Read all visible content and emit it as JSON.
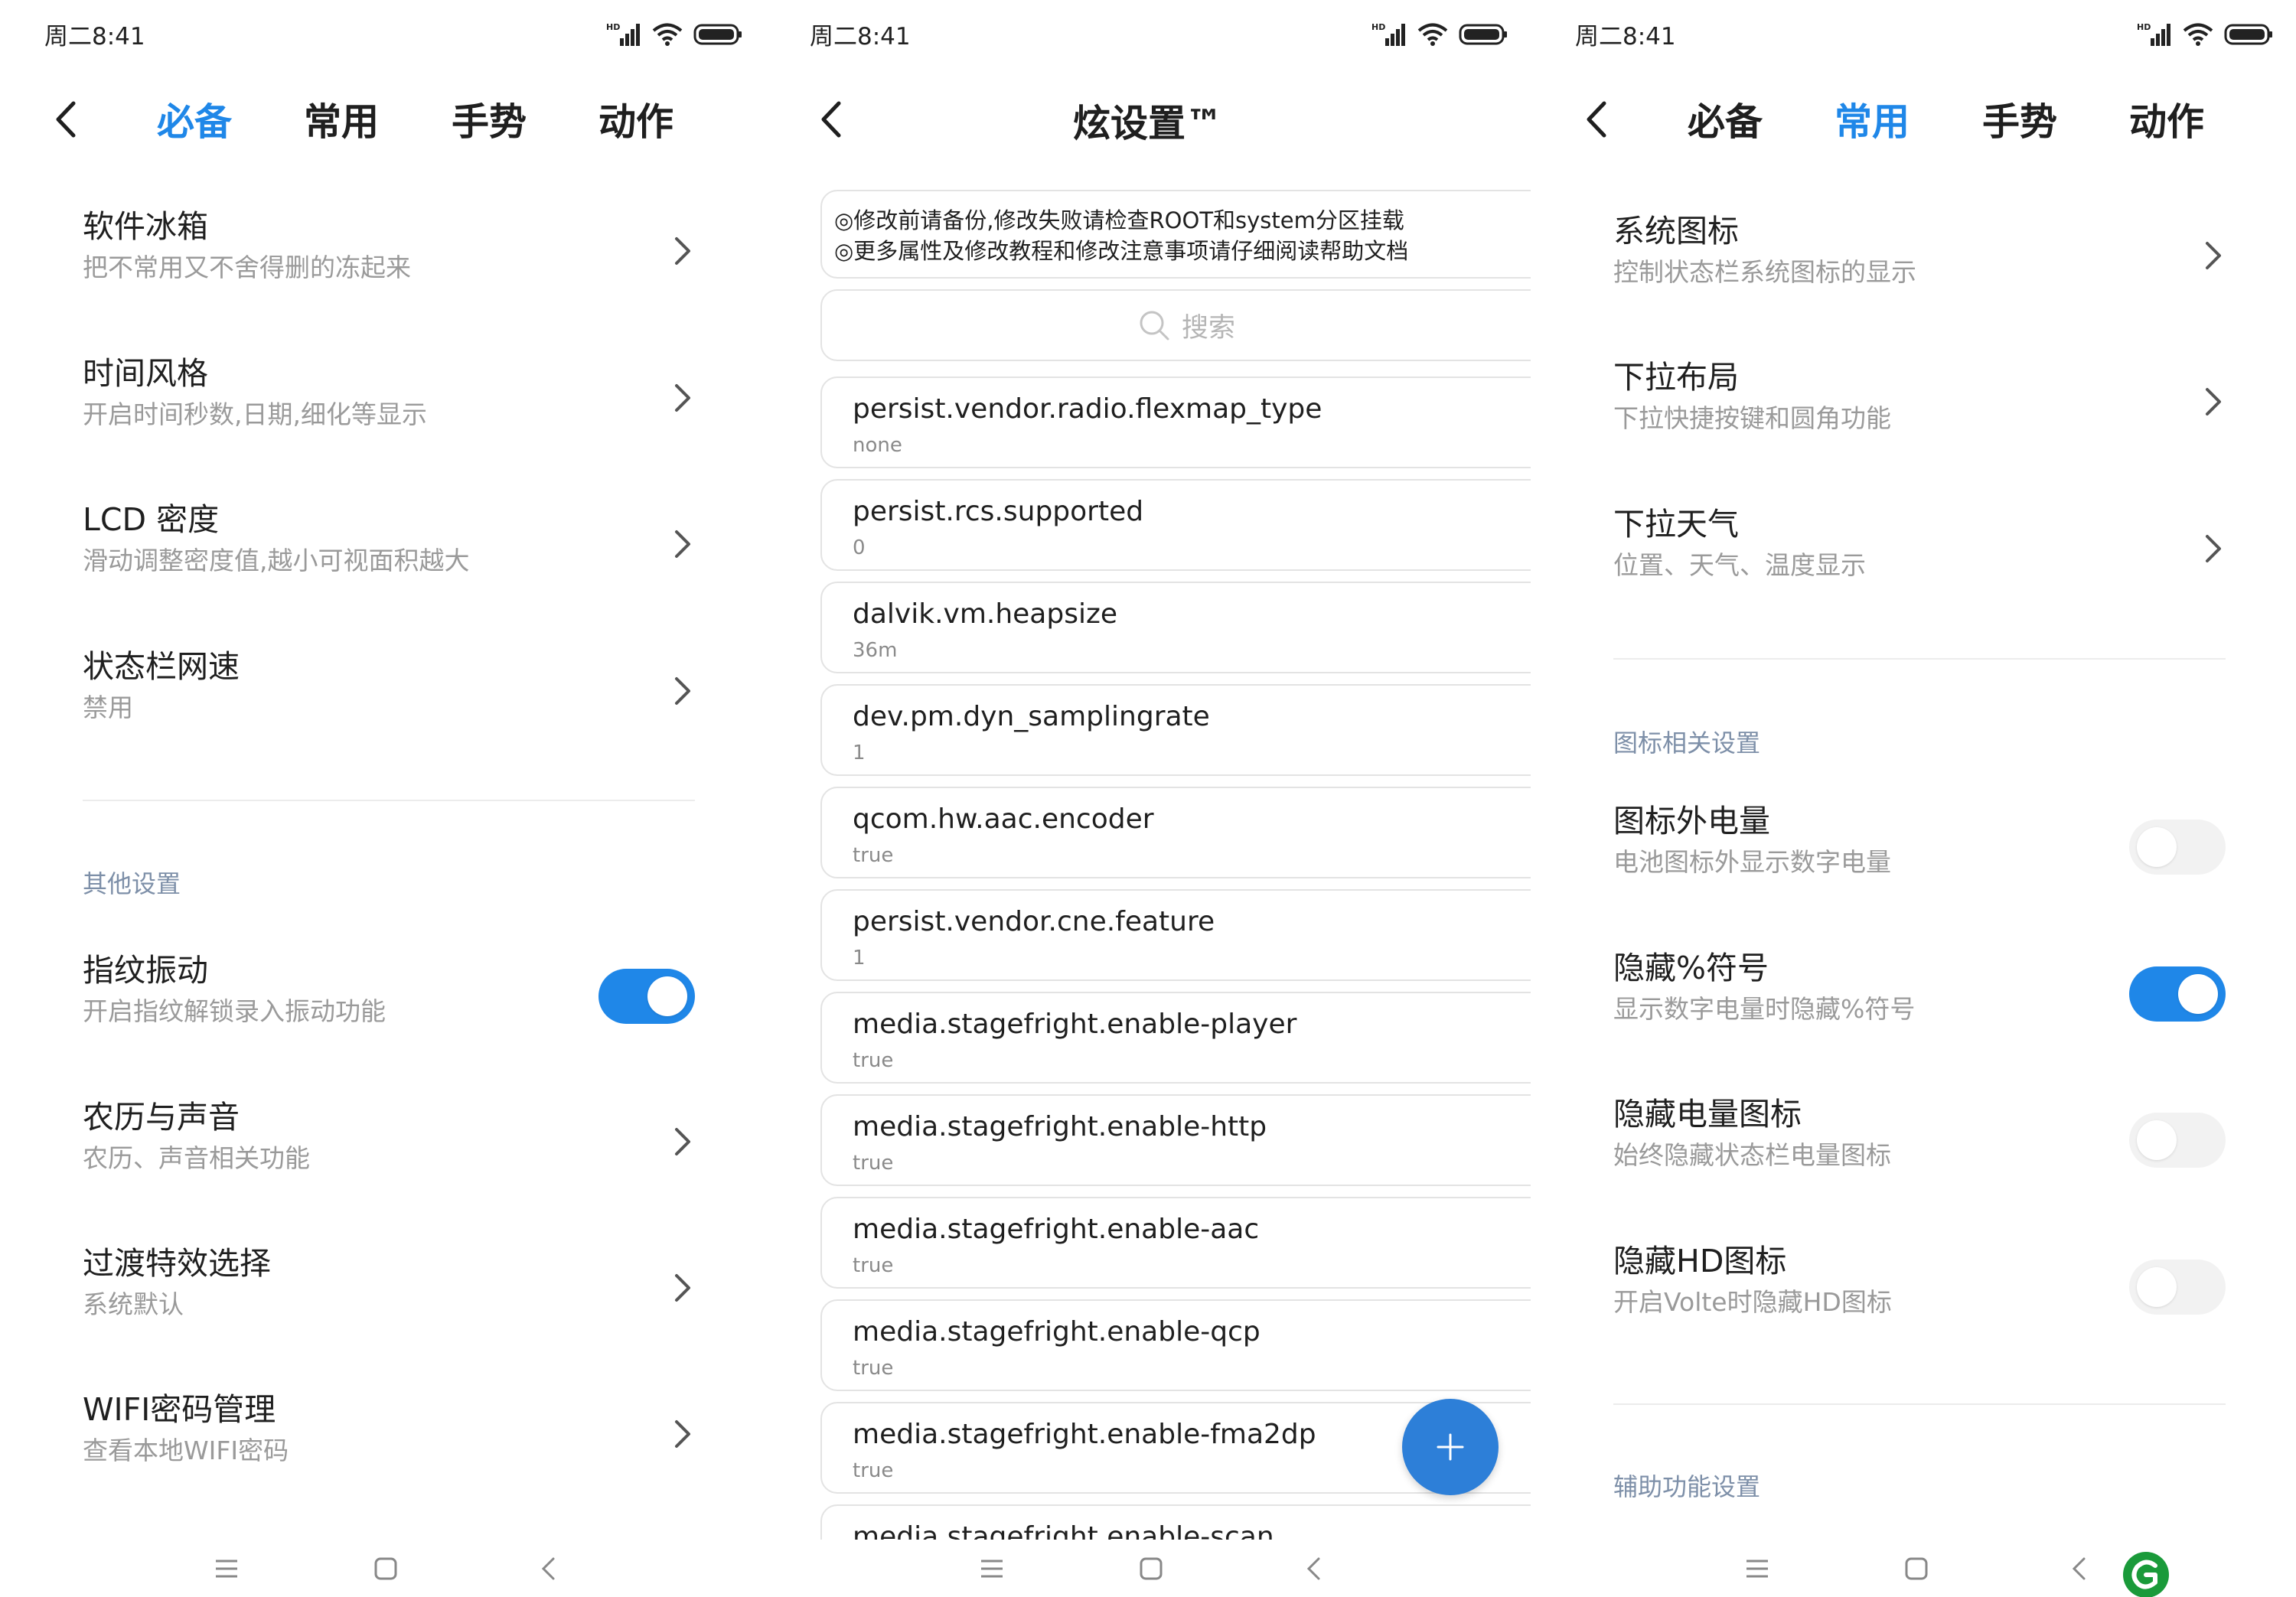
{
  "status_bar": {
    "time": "周二8:41"
  },
  "colors": {
    "accent": "#1f87e8",
    "fab": "#2d7fd8",
    "section_header": "#7d8fa8",
    "watermark": "#1a9a3a"
  },
  "panel_left": {
    "tabs": [
      "必备",
      "常用",
      "手势",
      "动作"
    ],
    "active_tab": "必备",
    "items": [
      {
        "title": "软件冰箱",
        "subtitle": "把不常用又不舍得删的冻起来",
        "control": "chevron"
      },
      {
        "title": "时间风格",
        "subtitle": "开启时间秒数,日期,细化等显示",
        "control": "chevron"
      },
      {
        "title": "LCD 密度",
        "subtitle": "滑动调整密度值,越小可视面积越大",
        "control": "chevron"
      },
      {
        "title": "状态栏网速",
        "subtitle": "禁用",
        "control": "chevron"
      }
    ],
    "section_other": "其他设置",
    "other_items": [
      {
        "title": "指纹振动",
        "subtitle": "开启指纹解锁录入振动功能",
        "control": "toggle",
        "on": true
      },
      {
        "title": "农历与声音",
        "subtitle": "农历、声音相关功能",
        "control": "chevron"
      },
      {
        "title": "过渡特效选择",
        "subtitle": "系统默认",
        "control": "chevron"
      },
      {
        "title": "WIFI密码管理",
        "subtitle": "查看本地WIFI密码",
        "control": "chevron"
      }
    ]
  },
  "panel_middle": {
    "title": "炫设置™",
    "notice": [
      "◎修改前请备份,修改失败请检查ROOT和system分区挂载",
      "◎更多属性及修改教程和修改注意事项请仔细阅读帮助文档"
    ],
    "search_placeholder": "搜索",
    "properties": [
      {
        "key": "persist.vendor.radio.flexmap_type",
        "value": "none"
      },
      {
        "key": "persist.rcs.supported",
        "value": "0"
      },
      {
        "key": "dalvik.vm.heapsize",
        "value": "36m"
      },
      {
        "key": "dev.pm.dyn_samplingrate",
        "value": "1"
      },
      {
        "key": "qcom.hw.aac.encoder",
        "value": "true"
      },
      {
        "key": "persist.vendor.cne.feature",
        "value": "1"
      },
      {
        "key": "media.stagefright.enable-player",
        "value": "true"
      },
      {
        "key": "media.stagefright.enable-http",
        "value": "true"
      },
      {
        "key": "media.stagefright.enable-aac",
        "value": "true"
      },
      {
        "key": "media.stagefright.enable-qcp",
        "value": "true"
      },
      {
        "key": "media.stagefright.enable-fma2dp",
        "value": "true"
      },
      {
        "key": "media.stagefright.enable-scan",
        "value": ""
      }
    ]
  },
  "panel_right": {
    "tabs": [
      "必备",
      "常用",
      "手势",
      "动作"
    ],
    "active_tab": "常用",
    "items": [
      {
        "title": "系统图标",
        "subtitle": "控制状态栏系统图标的显示",
        "control": "chevron"
      },
      {
        "title": "下拉布局",
        "subtitle": "下拉快捷按键和圆角功能",
        "control": "chevron"
      },
      {
        "title": "下拉天气",
        "subtitle": "位置、天气、温度显示",
        "control": "chevron"
      }
    ],
    "section_icons": "图标相关设置",
    "icon_items": [
      {
        "title": "图标外电量",
        "subtitle": "电池图标外显示数字电量",
        "control": "toggle",
        "on": false
      },
      {
        "title": "隐藏%符号",
        "subtitle": "显示数字电量时隐藏%符号",
        "control": "toggle",
        "on": true
      },
      {
        "title": "隐藏电量图标",
        "subtitle": "始终隐藏状态栏电量图标",
        "control": "toggle",
        "on": false
      },
      {
        "title": "隐藏HD图标",
        "subtitle": "开启Volte时隐藏HD图标",
        "control": "toggle",
        "on": false
      }
    ],
    "section_accessibility": "辅助功能设置"
  }
}
